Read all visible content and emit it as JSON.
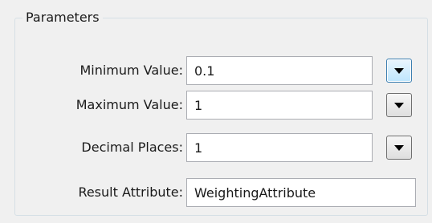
{
  "group": {
    "title": "Parameters"
  },
  "rows": [
    {
      "label": "Minimum Value:",
      "value": "0.1",
      "has_dropdown": true,
      "dropdown_focused": true
    },
    {
      "label": "Maximum Value:",
      "value": "1",
      "has_dropdown": true,
      "dropdown_focused": false
    },
    {
      "label": "Decimal Places:",
      "value": "1",
      "has_dropdown": true,
      "dropdown_focused": false
    },
    {
      "label": "Result Attribute:",
      "value": "WeightingAttribute",
      "has_dropdown": false
    }
  ],
  "icons": {
    "dropdown": "chevron-down-icon"
  }
}
